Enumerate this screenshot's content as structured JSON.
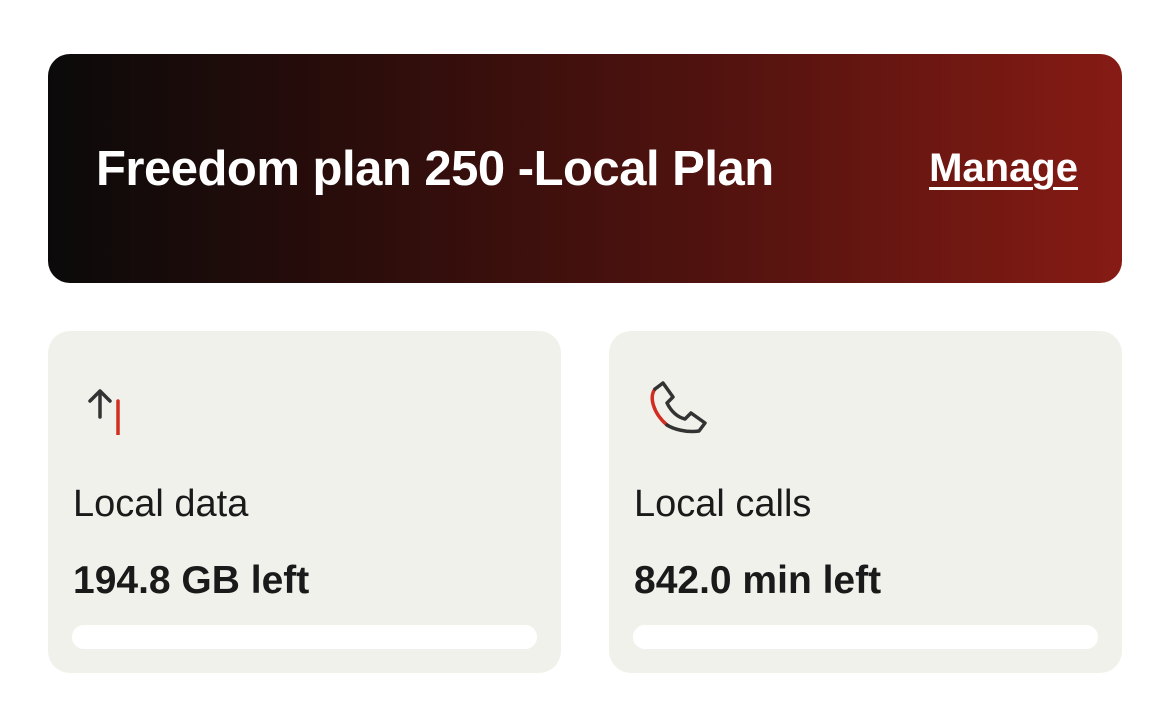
{
  "plan": {
    "title": "Freedom plan 250 -Local Plan",
    "manage_label": "Manage",
    "gradient_colors": [
      "#0b0a0a",
      "#861b14"
    ]
  },
  "cards": [
    {
      "icon": "data-transfer-arrows-icon",
      "label": "Local data",
      "value": "194.8 GB left"
    },
    {
      "icon": "phone-icon",
      "label": "Local calls",
      "value": "842.0 min left"
    }
  ],
  "colors": {
    "accent_red": "#d12d20",
    "icon_dark": "#333333",
    "card_bg": "#f1f1ec"
  }
}
